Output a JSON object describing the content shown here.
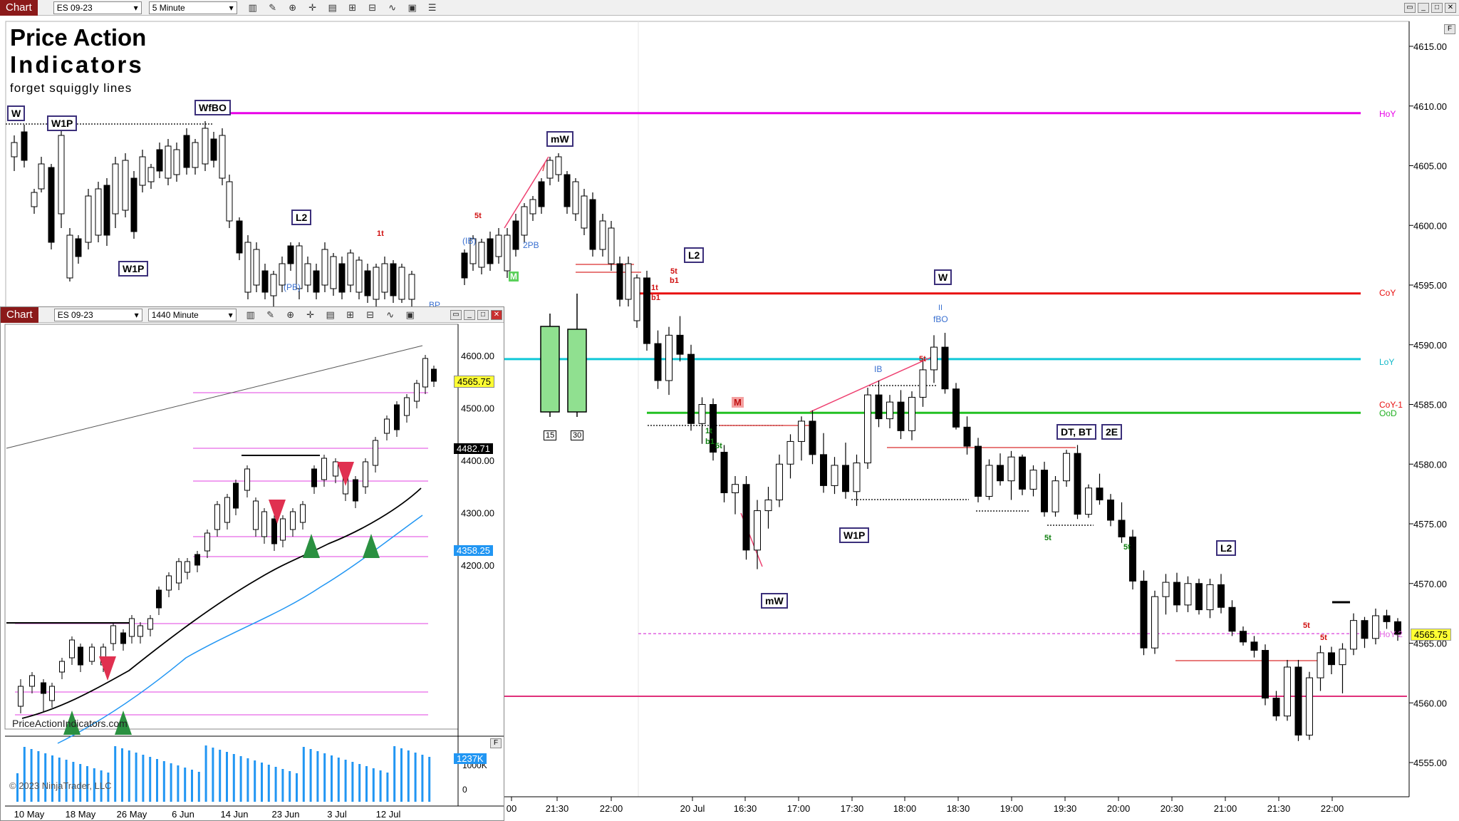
{
  "main_window": {
    "tab": "Chart",
    "instrument": "ES 09-23",
    "interval": "5 Minute",
    "toolbar_icons": [
      "bar-type-icon",
      "pencil-icon",
      "zoom-in-icon",
      "crosshair-icon",
      "properties-icon",
      "templates-icon",
      "strategies-icon",
      "drawing-tools-icon",
      "data-box-icon",
      "chart-trader-icon"
    ],
    "window_buttons": [
      "restore-icon",
      "minimize-icon",
      "maximize-icon",
      "close-icon"
    ]
  },
  "branding": {
    "title_line1": "Price Action",
    "title_line2": "Indicators",
    "tagline": "forget squiggly lines"
  },
  "main_price_axis": {
    "ticks": [
      "4615.00",
      "4610.00",
      "4605.00",
      "4600.00",
      "4595.00",
      "4590.00",
      "4585.00",
      "4580.00",
      "4575.00",
      "4570.00",
      "4565.00",
      "4560.00",
      "4555.00"
    ],
    "current_price": "4565.75"
  },
  "main_time_axis": [
    "00",
    "21:30",
    "22:00",
    "20 Jul",
    "16:30",
    "17:00",
    "17:30",
    "18:00",
    "18:30",
    "19:00",
    "19:30",
    "20:00",
    "20:30",
    "21:00",
    "21:30",
    "22:00"
  ],
  "level_labels": {
    "hoy": "HoY",
    "coy": "CoY",
    "loy": "LoY",
    "coy1": "CoY-1",
    "ood": "OoD",
    "hoy2": "HoY-2"
  },
  "colors": {
    "hoy": "#e800e8",
    "coy": "#e81010",
    "loy": "#10c8d8",
    "ood": "#22c022",
    "hoy2": "#e060e0",
    "pink_line": "#e0307a",
    "bull_candle": "#ffffff",
    "bear_candle": "#000000",
    "price_marker": "#ffff33",
    "tab": "#8b1a1a"
  },
  "annotations": {
    "w_top": "W",
    "w1p_top": "W1P",
    "wfbo": "WfBO",
    "w1p_left": "W1P",
    "l2_a": "L2",
    "mw_a": "mW",
    "l2_b": "L2",
    "w_mid": "W",
    "w1p_mid": "W1P",
    "mw_b": "mW",
    "dtbt": "DT, BT",
    "two_e": "2E",
    "l2_c": "L2",
    "five_t": "5t",
    "one_t": "1t",
    "b1": "b1",
    "two_pb": "2PB",
    "ib": "IB",
    "pb": "(PB)",
    "ib_paren": "(IB)",
    "fbo": "fBO",
    "ii": "II",
    "bp": "BP",
    "m_green": "M",
    "m_red": "M",
    "box15": "15",
    "box30": "30"
  },
  "inset_window": {
    "tab": "Chart",
    "instrument": "ES 09-23",
    "interval": "1440 Minute",
    "price_ticks": [
      "4600.00",
      "4500.00",
      "4400.00",
      "4300.00",
      "4200.00"
    ],
    "price_markers": {
      "last": "4565.75",
      "ema": "4482.71",
      "sma": "4358.25"
    },
    "volume_marker": "1237K",
    "volume_ticks": [
      "1000K",
      "0"
    ],
    "date_axis": [
      "10 May",
      "18 May",
      "26 May",
      "6 Jun",
      "14 Jun",
      "23 Jun",
      "3 Jul",
      "12 Jul"
    ],
    "watermark": "PriceActionIndicators.com",
    "copyright": "© 2023 NinjaTrader, LLC"
  },
  "chart_data": {
    "type": "candlestick",
    "instrument": "ES 09-23",
    "timeframe": "5 Minute",
    "ylim": [
      4553,
      4617
    ],
    "levels": [
      {
        "name": "HoY",
        "value": 4609.4
      },
      {
        "name": "CoY",
        "value": 4594.3
      },
      {
        "name": "LoY",
        "value": 4588.8
      },
      {
        "name": "OoD",
        "value": 4584.3
      },
      {
        "name": "HoY-2",
        "value": 4565.8
      }
    ],
    "last_price": 4565.75,
    "candles": [
      [
        4595.6,
        4596.2,
        4589.5,
        4590.1
      ],
      [
        4590.1,
        4591.2,
        4586.3,
        4587.0
      ],
      [
        4587.0,
        4591.5,
        4585.8,
        4590.8
      ],
      [
        4590.8,
        4592.4,
        4588.6,
        4589.2
      ],
      [
        4589.2,
        4590.0,
        4582.8,
        4583.4
      ],
      [
        4583.4,
        4585.6,
        4581.7,
        4585.0
      ],
      [
        4585.0,
        4585.5,
        4580.3,
        4581.0
      ],
      [
        4581.0,
        4581.6,
        4576.8,
        4577.6
      ],
      [
        4577.6,
        4579.0,
        4575.8,
        4578.3
      ],
      [
        4578.3,
        4579.0,
        4572.0,
        4572.8
      ],
      [
        4572.8,
        4577.0,
        4571.2,
        4576.1
      ],
      [
        4576.1,
        4578.1,
        4574.6,
        4577.0
      ],
      [
        4577.0,
        4580.8,
        4576.4,
        4580.0
      ],
      [
        4580.0,
        4582.5,
        4578.8,
        4581.9
      ],
      [
        4581.9,
        4584.0,
        4580.3,
        4583.6
      ],
      [
        4583.6,
        4584.5,
        4580.0,
        4580.8
      ],
      [
        4580.8,
        4582.6,
        4577.6,
        4578.2
      ],
      [
        4578.2,
        4580.6,
        4577.5,
        4579.9
      ],
      [
        4579.9,
        4581.8,
        4577.1,
        4577.7
      ],
      [
        4577.7,
        4580.8,
        4576.5,
        4580.1
      ],
      [
        4580.1,
        4586.4,
        4579.6,
        4585.8
      ],
      [
        4585.8,
        4587.0,
        4583.1,
        4583.8
      ],
      [
        4583.8,
        4585.8,
        4583.0,
        4585.2
      ],
      [
        4585.2,
        4586.2,
        4582.1,
        4582.8
      ],
      [
        4582.8,
        4586.1,
        4582.0,
        4585.6
      ],
      [
        4585.6,
        4588.6,
        4584.8,
        4587.9
      ],
      [
        4587.9,
        4590.8,
        4586.8,
        4589.8
      ],
      [
        4589.8,
        4591.0,
        4585.9,
        4586.3
      ],
      [
        4586.3,
        4586.8,
        4582.9,
        4583.1
      ],
      [
        4583.1,
        4584.0,
        4580.8,
        4581.5
      ],
      [
        4581.5,
        4582.2,
        4576.8,
        4577.3
      ],
      [
        4577.3,
        4580.4,
        4577.0,
        4579.9
      ],
      [
        4579.9,
        4580.9,
        4578.2,
        4578.6
      ],
      [
        4578.6,
        4581.1,
        4577.0,
        4580.6
      ],
      [
        4580.6,
        4580.8,
        4577.4,
        4577.9
      ],
      [
        4577.9,
        4579.9,
        4577.3,
        4579.5
      ],
      [
        4579.5,
        4580.2,
        4575.6,
        4576.0
      ],
      [
        4576.0,
        4579.0,
        4575.6,
        4578.6
      ],
      [
        4578.6,
        4581.2,
        4578.1,
        4580.9
      ],
      [
        4580.9,
        4581.6,
        4575.4,
        4575.8
      ],
      [
        4575.8,
        4578.3,
        4575.5,
        4578.0
      ],
      [
        4578.0,
        4579.2,
        4576.6,
        4577.0
      ],
      [
        4577.0,
        4577.5,
        4574.8,
        4575.3
      ],
      [
        4575.3,
        4576.8,
        4573.4,
        4573.9
      ],
      [
        4573.9,
        4574.5,
        4569.5,
        4570.2
      ],
      [
        4570.2,
        4571.1,
        4564.0,
        4564.6
      ],
      [
        4564.6,
        4569.4,
        4564.1,
        4568.9
      ],
      [
        4568.9,
        4570.8,
        4567.4,
        4570.1
      ],
      [
        4570.1,
        4570.9,
        4567.6,
        4568.2
      ],
      [
        4568.2,
        4570.6,
        4567.6,
        4570.0
      ],
      [
        4570.0,
        4570.4,
        4567.4,
        4567.8
      ],
      [
        4567.8,
        4570.4,
        4567.1,
        4569.9
      ],
      [
        4569.9,
        4570.8,
        4567.5,
        4568.0
      ],
      [
        4568.0,
        4568.6,
        4565.6,
        4566.0
      ],
      [
        4566.0,
        4566.4,
        4564.8,
        4565.1
      ],
      [
        4565.1,
        4565.6,
        4563.8,
        4564.4
      ],
      [
        4564.4,
        4564.9,
        4559.8,
        4560.4
      ],
      [
        4560.4,
        4561.0,
        4558.5,
        4558.9
      ],
      [
        4558.9,
        4563.6,
        4558.5,
        4563.0
      ],
      [
        4563.0,
        4563.6,
        4556.8,
        4557.3
      ],
      [
        4557.3,
        4562.6,
        4556.9,
        4562.1
      ],
      [
        4562.1,
        4564.8,
        4561.0,
        4564.2
      ],
      [
        4564.2,
        4564.7,
        4562.4,
        4563.2
      ],
      [
        4563.2,
        4565.0,
        4560.8,
        4564.5
      ],
      [
        4564.5,
        4567.5,
        4564.0,
        4566.9
      ],
      [
        4566.9,
        4567.2,
        4564.6,
        4565.4
      ],
      [
        4565.4,
        4567.9,
        4564.9,
        4567.3
      ],
      [
        4567.3,
        4567.8,
        4566.2,
        4566.8
      ],
      [
        4566.8,
        4567.1,
        4565.2,
        4565.75
      ]
    ]
  }
}
